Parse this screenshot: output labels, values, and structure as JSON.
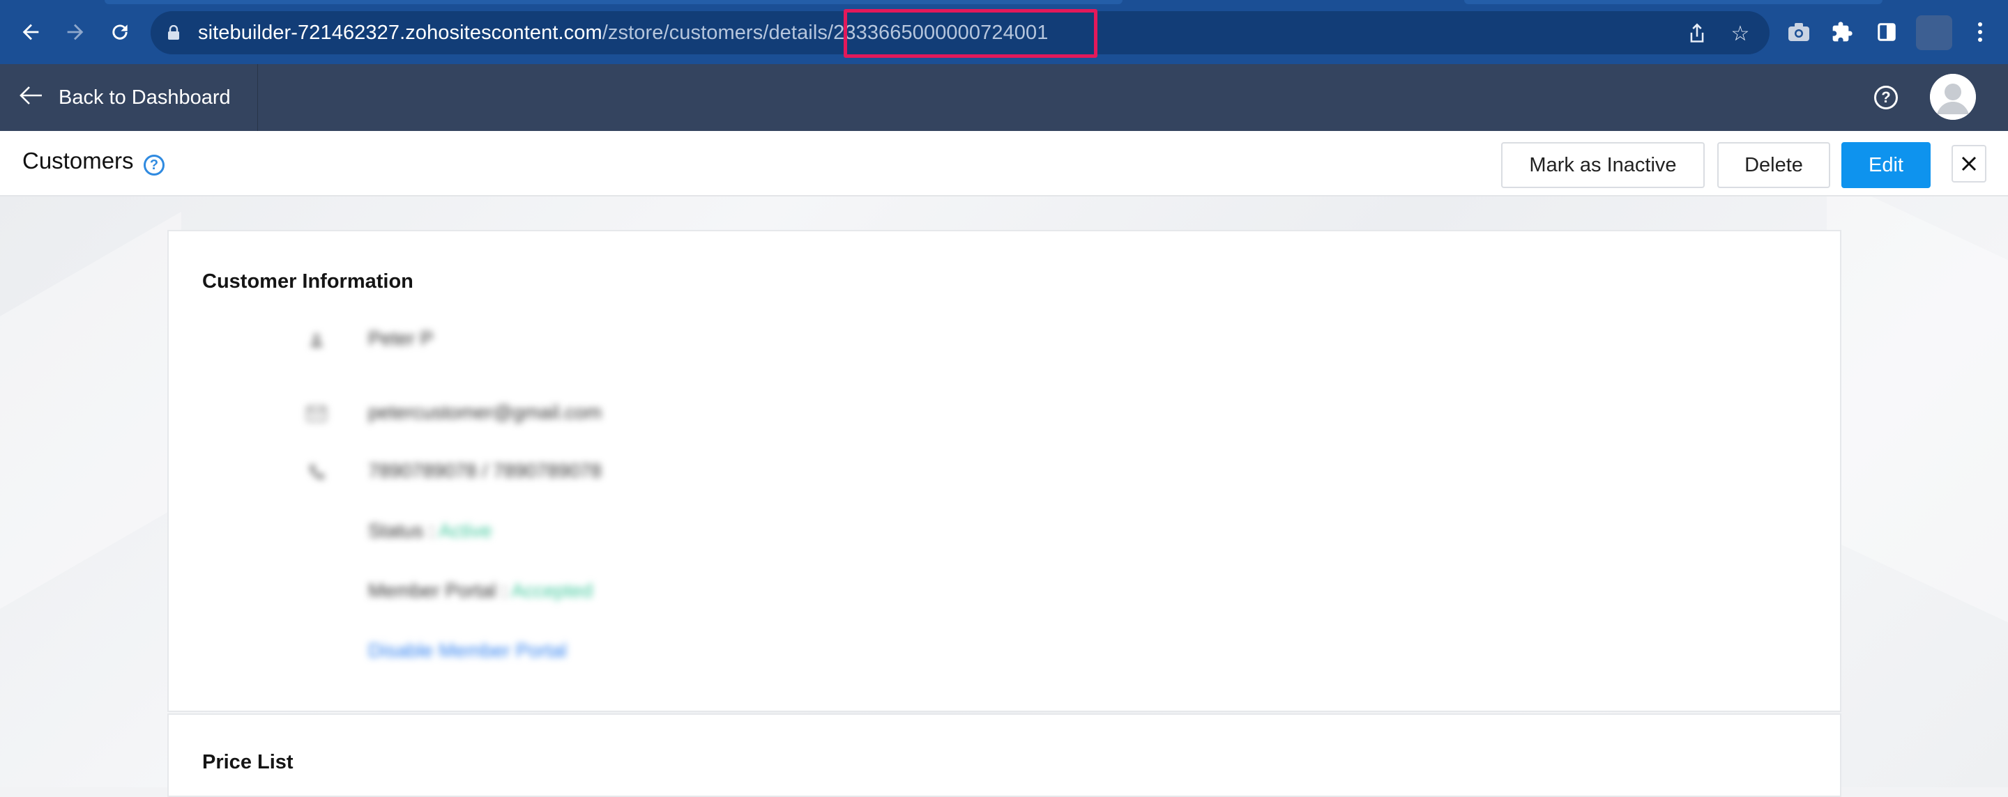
{
  "browser": {
    "url_host": "sitebuilder-721462327.zohositescontent.com",
    "url_path": "/zstore/customers/details",
    "url_id": "/2333665000000724001",
    "icons": {
      "back": "arrow-left-icon",
      "forward": "arrow-right-icon",
      "reload": "reload-icon",
      "lock": "lock-icon",
      "share": "share-icon",
      "bookmark": "star-icon",
      "camera": "camera-icon",
      "extensions": "puzzle-icon",
      "sidepanel": "sidepanel-icon",
      "menu": "kebab-menu-icon"
    },
    "highlight_color": "#e3195a"
  },
  "header": {
    "back_label": "Back to Dashboard"
  },
  "toolbar": {
    "title": "Customers",
    "mark_inactive_label": "Mark as Inactive",
    "delete_label": "Delete",
    "edit_label": "Edit",
    "primary_color": "#0e93ee"
  },
  "customer_info": {
    "heading": "Customer Information",
    "name": "Peter P",
    "email": "petercustomer@gmail.com",
    "phone": "7890789078 / 7890789078",
    "status_label": "Status :",
    "status_value": "Active",
    "member_portal_label": "Member Portal :",
    "member_portal_value": "Accepted",
    "member_portal_link": "Disable Member Portal"
  },
  "price_list": {
    "heading": "Price List"
  }
}
